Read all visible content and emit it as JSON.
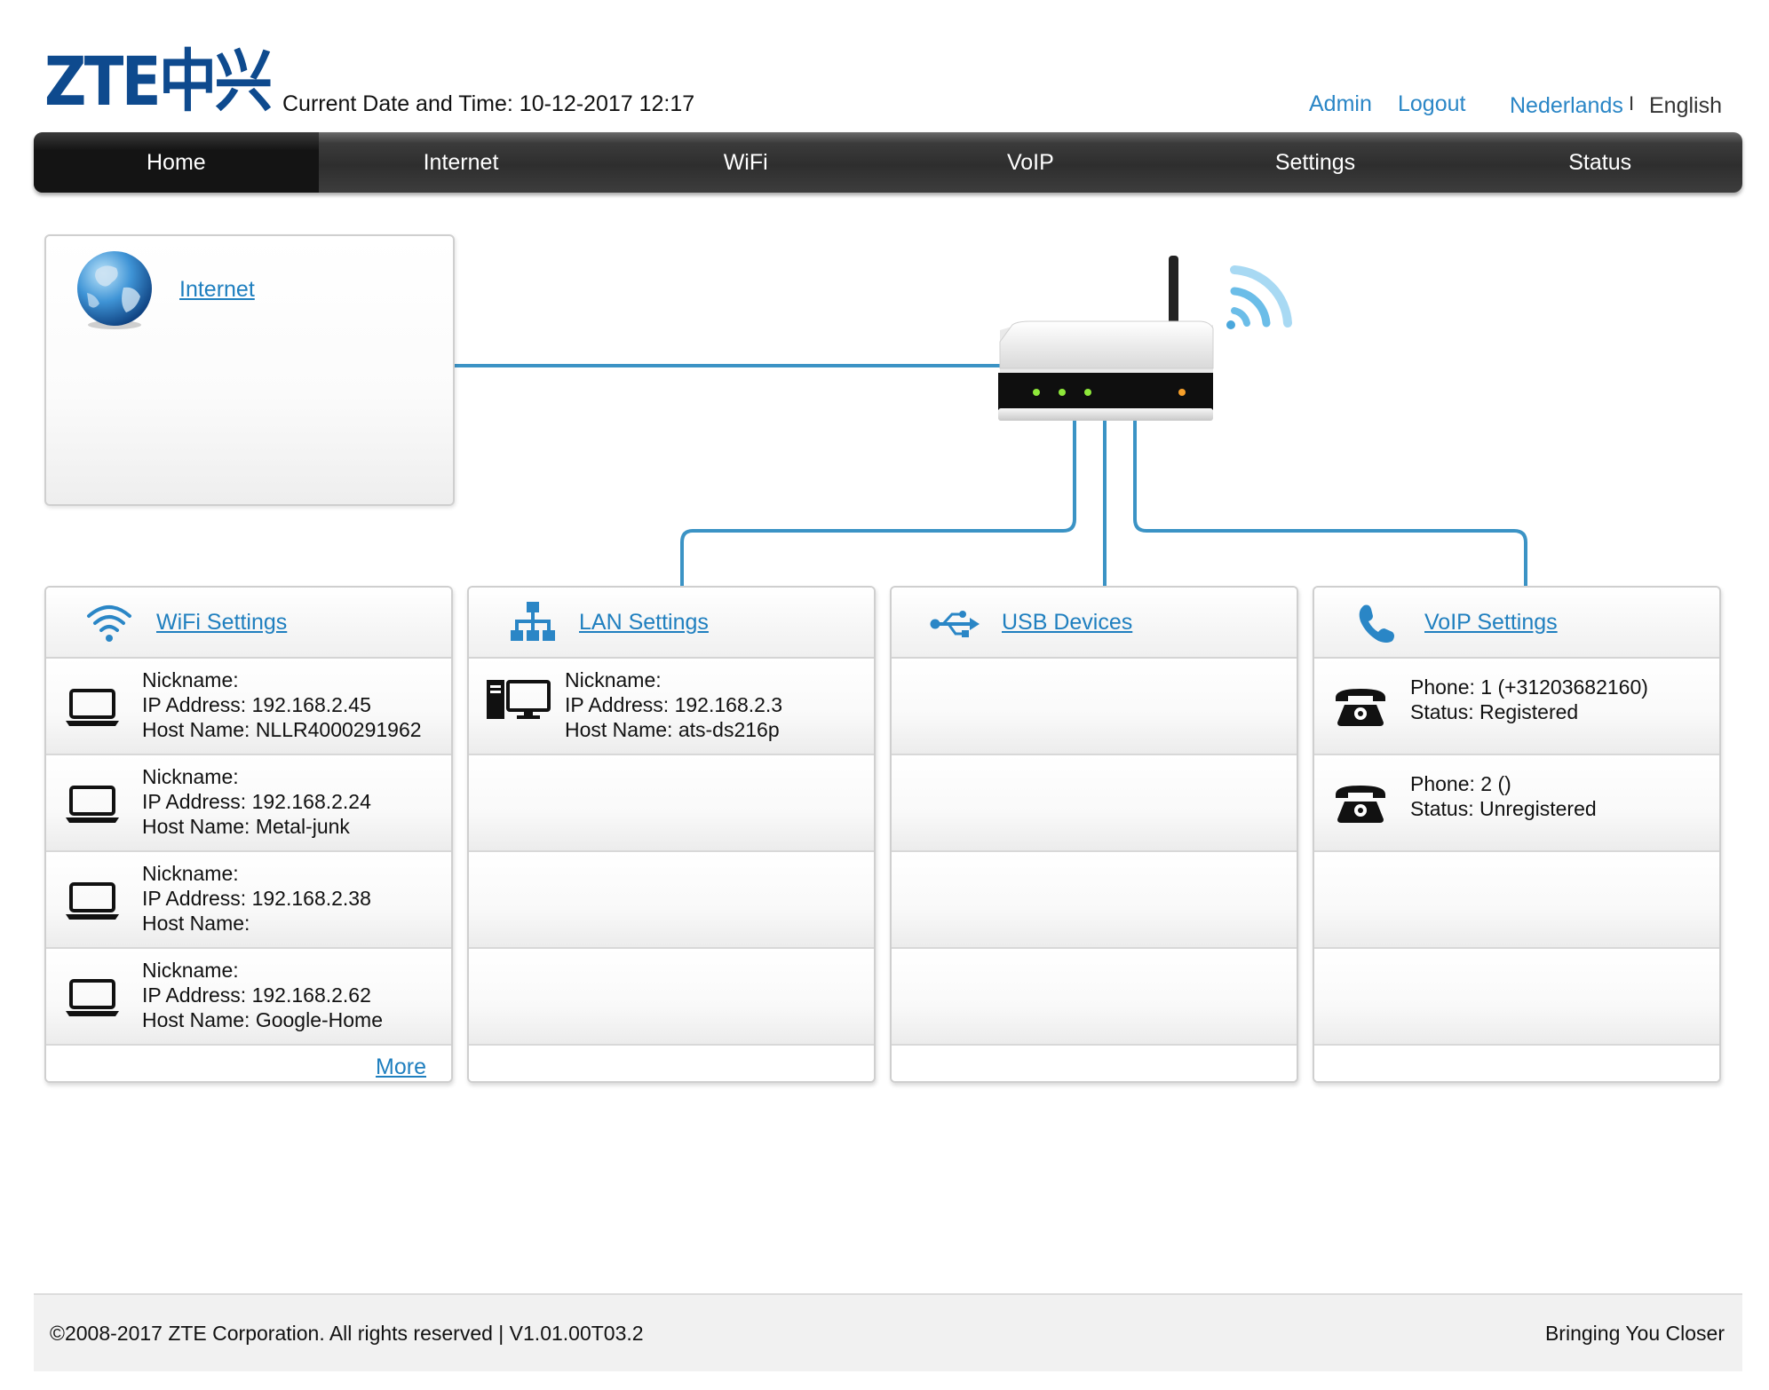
{
  "header": {
    "logo_text": "ZTE中兴",
    "datetime": "Current Date and Time: 10-12-2017 12:17",
    "admin_label": "Admin",
    "logout_label": "Logout",
    "lang_nl": "Nederlands",
    "lang_sep": "I",
    "lang_en": "English"
  },
  "nav": {
    "items": [
      {
        "label": "Home"
      },
      {
        "label": "Internet"
      },
      {
        "label": "WiFi"
      },
      {
        "label": "VoIP"
      },
      {
        "label": "Settings"
      },
      {
        "label": "Status"
      }
    ],
    "active": "Home"
  },
  "internet_card": {
    "label": "Internet"
  },
  "panels": {
    "wifi": {
      "title": "WiFi Settings",
      "devices": [
        {
          "nickname": "Nickname:",
          "ip": "IP Address: 192.168.2.45",
          "host": "Host Name: NLLR4000291962"
        },
        {
          "nickname": "Nickname:",
          "ip": "IP Address: 192.168.2.24",
          "host": "Host Name: Metal-junk"
        },
        {
          "nickname": "Nickname:",
          "ip": "IP Address: 192.168.2.38",
          "host": "Host Name:"
        },
        {
          "nickname": "Nickname:",
          "ip": "IP Address: 192.168.2.62",
          "host": "Host Name: Google-Home"
        }
      ],
      "more_label": "More"
    },
    "lan": {
      "title": "LAN Settings",
      "devices": [
        {
          "nickname": "Nickname:",
          "ip": "IP Address: 192.168.2.3",
          "host": "Host Name: ats-ds216p"
        }
      ]
    },
    "usb": {
      "title": "USB Devices"
    },
    "voip": {
      "title": "VoIP Settings",
      "phones": [
        {
          "phone": "Phone: 1 (+31203682160)",
          "status": "Status: Registered"
        },
        {
          "phone": "Phone: 2 ()",
          "status": "Status: Unregistered"
        }
      ]
    }
  },
  "footer": {
    "copyright": "©2008-2017 ZTE Corporation. All rights reserved  |   V1.01.00T03.2",
    "slogan": "Bringing You Closer"
  },
  "colors": {
    "brand": "#0e4a8e",
    "link": "#1f7fbf",
    "line": "#3b93c5",
    "nav_bg": "#2e2e2e"
  }
}
